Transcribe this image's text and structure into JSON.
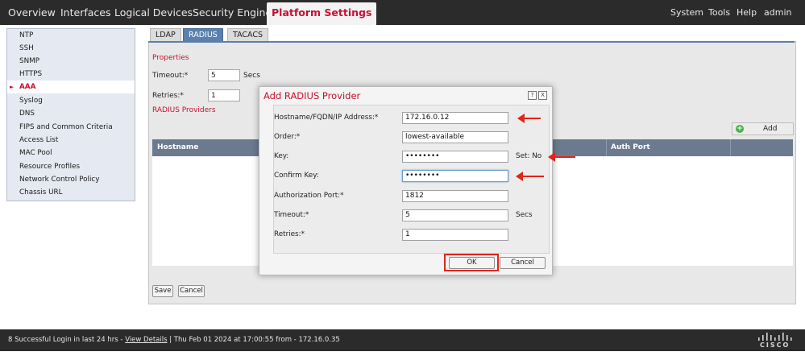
{
  "nav": {
    "items": [
      "Overview",
      "Interfaces",
      "Logical Devices",
      "Security Engine",
      "Platform Settings"
    ],
    "active": "Platform Settings",
    "right": [
      "System",
      "Tools",
      "Help",
      "admin"
    ]
  },
  "sidebar": {
    "items": [
      "NTP",
      "SSH",
      "SNMP",
      "HTTPS",
      "AAA",
      "Syslog",
      "DNS",
      "FIPS and Common Criteria",
      "Access List",
      "MAC Pool",
      "Resource Profiles",
      "Network Control Policy",
      "Chassis URL"
    ],
    "active": "AAA"
  },
  "subtabs": [
    "LDAP",
    "RADIUS",
    "TACACS"
  ],
  "properties": {
    "title": "Properties",
    "timeout_label": "Timeout:*",
    "timeout_value": "5",
    "timeout_unit": "Secs",
    "retries_label": "Retries:*",
    "retries_value": "1"
  },
  "providers": {
    "title": "RADIUS Providers",
    "add_label": "Add",
    "columns": [
      "Hostname",
      "Auth Port"
    ]
  },
  "bottom_buttons": {
    "save": "Save",
    "cancel": "Cancel"
  },
  "modal": {
    "title": "Add RADIUS Provider",
    "help": "?",
    "close": "X",
    "hostname_label": "Hostname/FQDN/IP Address:*",
    "hostname_value": "172.16.0.12",
    "order_label": "Order:*",
    "order_value": "lowest-available",
    "key_label": "Key:",
    "key_value": "••••••••",
    "key_set": "Set: No",
    "confirm_label": "Confirm Key:",
    "confirm_value": "••••••••",
    "authport_label": "Authorization Port:*",
    "authport_value": "1812",
    "timeout_label": "Timeout:*",
    "timeout_value": "5",
    "timeout_unit": "Secs",
    "retries_label": "Retries:*",
    "retries_value": "1",
    "ok": "OK",
    "cancel": "Cancel"
  },
  "footer": {
    "prefix": "8 Successful Login in last 24 hrs - ",
    "link": "View Details",
    "suffix": " | Thu Feb 01 2024 at 17:00:55 from - 172.16.0.35",
    "logo_text": "CISCO"
  },
  "colors": {
    "accent": "#c8102e",
    "tab_active": "#5b7fae",
    "annotation": "#e0261b"
  }
}
